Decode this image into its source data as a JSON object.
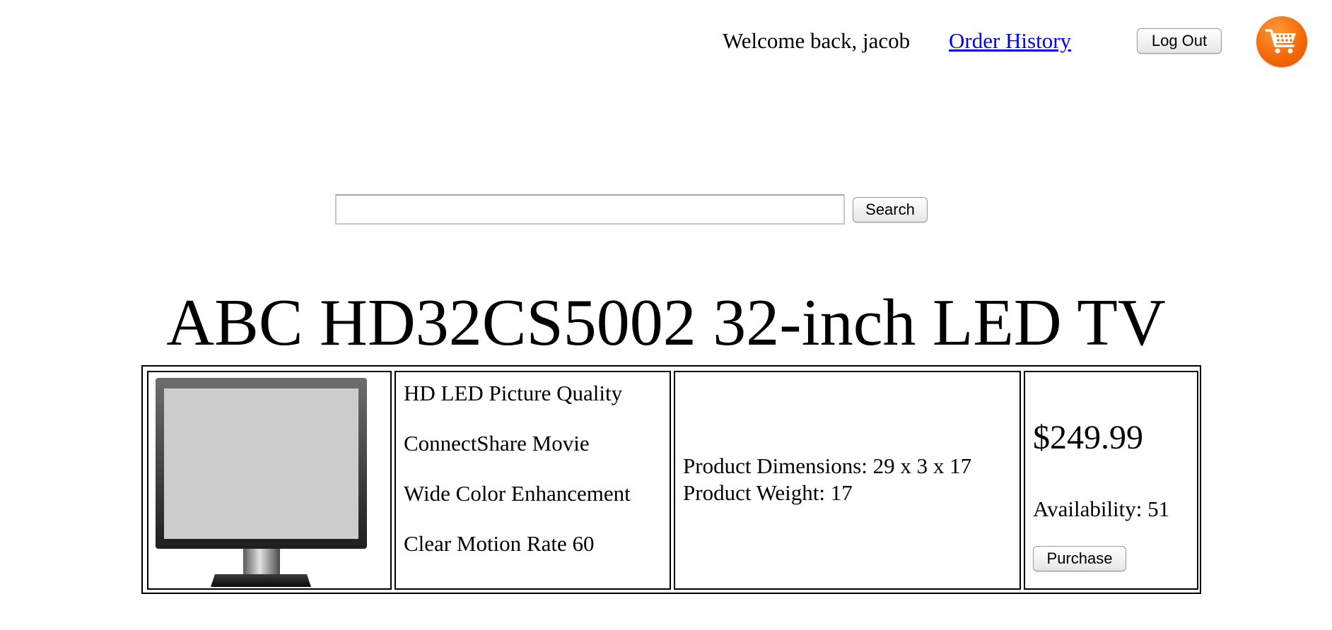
{
  "header": {
    "welcome_text": "Welcome back, jacob",
    "order_history_label": "Order History",
    "logout_label": "Log Out",
    "cart_icon": "shopping-cart-icon",
    "cart_color": "#f56a08"
  },
  "search": {
    "placeholder": "",
    "value": "",
    "button_label": "Search"
  },
  "product": {
    "title": "ABC HD32CS5002 32-inch LED TV",
    "image_icon": "tv-monitor-icon",
    "features": [
      "HD LED Picture Quality",
      "ConnectShare Movie",
      "Wide Color Enhancement",
      "Clear Motion Rate 60"
    ],
    "specs": {
      "dimensions": "Product Dimensions: 29 x 3 x 17",
      "weight": "Product Weight: 17"
    },
    "price": "$249.99",
    "availability": "Availability: 51",
    "purchase_label": "Purchase"
  },
  "colors": {
    "link": "#0000ee",
    "cart_orange": "#f56a08"
  }
}
